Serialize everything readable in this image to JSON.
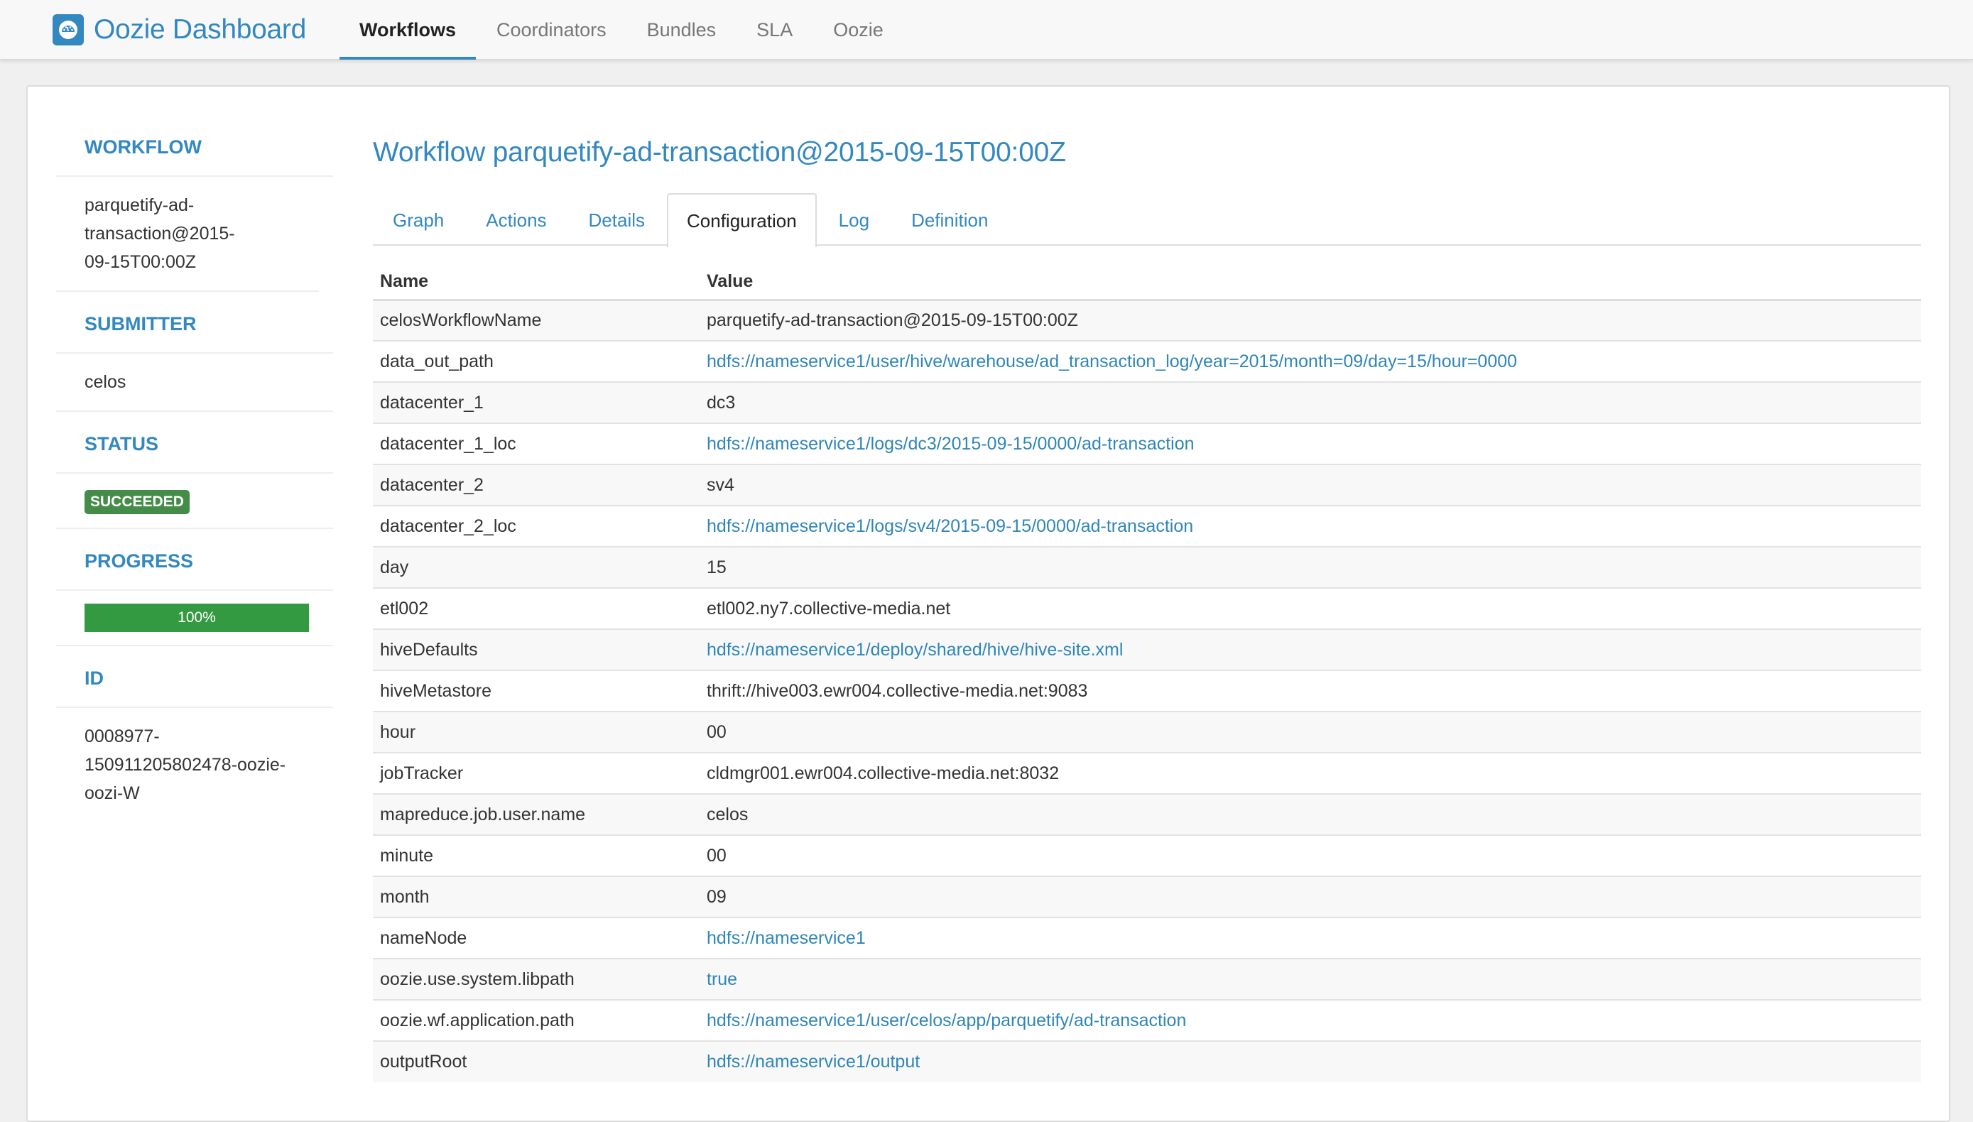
{
  "navbar": {
    "brand": "Oozie Dashboard",
    "brand_icon": "dashboard-gauge-icon",
    "items": [
      {
        "label": "Workflows",
        "active": true
      },
      {
        "label": "Coordinators",
        "active": false
      },
      {
        "label": "Bundles",
        "active": false
      },
      {
        "label": "SLA",
        "active": false
      },
      {
        "label": "Oozie",
        "active": false
      }
    ]
  },
  "sidebar": {
    "workflow_label": "WORKFLOW",
    "workflow_value": "parquetify-ad-transaction@2015-09-15T00:00Z",
    "submitter_label": "SUBMITTER",
    "submitter_value": "celos",
    "status_label": "STATUS",
    "status_value": "SUCCEEDED",
    "status_color": "#458c49",
    "progress_label": "PROGRESS",
    "progress_percent": 100,
    "progress_text": "100%",
    "progress_color": "#339a42",
    "id_label": "ID",
    "id_value": "0008977-150911205802478-oozie-oozi-W"
  },
  "main": {
    "title": "Workflow parquetify-ad-transaction@2015-09-15T00:00Z",
    "tabs": [
      {
        "label": "Graph",
        "active": false
      },
      {
        "label": "Actions",
        "active": false
      },
      {
        "label": "Details",
        "active": false
      },
      {
        "label": "Configuration",
        "active": true
      },
      {
        "label": "Log",
        "active": false
      },
      {
        "label": "Definition",
        "active": false
      }
    ],
    "table": {
      "headers": [
        "Name",
        "Value"
      ],
      "rows": [
        {
          "name": "celosWorkflowName",
          "value": "parquetify-ad-transaction@2015-09-15T00:00Z",
          "link": false
        },
        {
          "name": "data_out_path",
          "value": "hdfs://nameservice1/user/hive/warehouse/ad_transaction_log/year=2015/month=09/day=15/hour=0000",
          "link": true
        },
        {
          "name": "datacenter_1",
          "value": "dc3",
          "link": false
        },
        {
          "name": "datacenter_1_loc",
          "value": "hdfs://nameservice1/logs/dc3/2015-09-15/0000/ad-transaction",
          "link": true
        },
        {
          "name": "datacenter_2",
          "value": "sv4",
          "link": false
        },
        {
          "name": "datacenter_2_loc",
          "value": "hdfs://nameservice1/logs/sv4/2015-09-15/0000/ad-transaction",
          "link": true
        },
        {
          "name": "day",
          "value": "15",
          "link": false
        },
        {
          "name": "etl002",
          "value": "etl002.ny7.collective-media.net",
          "link": false
        },
        {
          "name": "hiveDefaults",
          "value": "hdfs://nameservice1/deploy/shared/hive/hive-site.xml",
          "link": true
        },
        {
          "name": "hiveMetastore",
          "value": "thrift://hive003.ewr004.collective-media.net:9083",
          "link": false
        },
        {
          "name": "hour",
          "value": "00",
          "link": false
        },
        {
          "name": "jobTracker",
          "value": "cldmgr001.ewr004.collective-media.net:8032",
          "link": false
        },
        {
          "name": "mapreduce.job.user.name",
          "value": "celos",
          "link": false
        },
        {
          "name": "minute",
          "value": "00",
          "link": false
        },
        {
          "name": "month",
          "value": "09",
          "link": false
        },
        {
          "name": "nameNode",
          "value": "hdfs://nameservice1",
          "link": true
        },
        {
          "name": "oozie.use.system.libpath",
          "value": "true",
          "link": true
        },
        {
          "name": "oozie.wf.application.path",
          "value": "hdfs://nameservice1/user/celos/app/parquetify/ad-transaction",
          "link": true
        },
        {
          "name": "outputRoot",
          "value": "hdfs://nameservice1/output",
          "link": true
        }
      ]
    }
  }
}
